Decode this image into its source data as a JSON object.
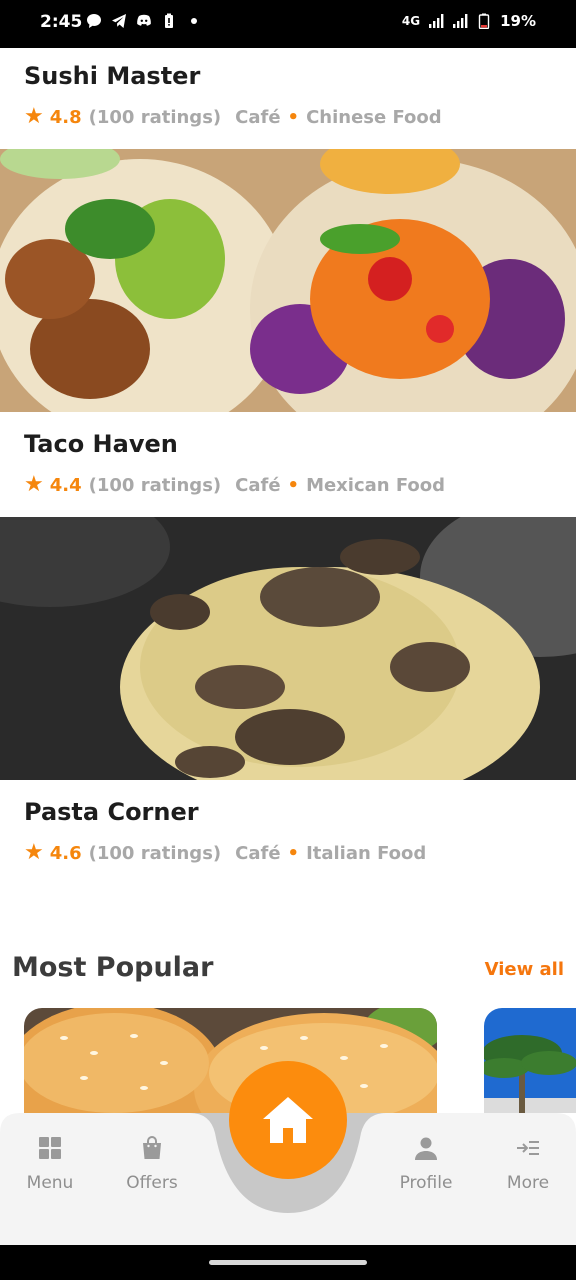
{
  "status": {
    "time": "2:45",
    "network": "4G",
    "battery": "19%"
  },
  "restaurants": [
    {
      "name": "Sushi Master",
      "rating": "4.8",
      "ratings_count": "(100 ratings)",
      "type": "Café",
      "cuisine": "Chinese Food"
    },
    {
      "name": "Taco Haven",
      "rating": "4.4",
      "ratings_count": "(100 ratings)",
      "type": "Café",
      "cuisine": "Mexican Food"
    },
    {
      "name": "Pasta Corner",
      "rating": "4.6",
      "ratings_count": "(100 ratings)",
      "type": "Café",
      "cuisine": "Italian Food"
    }
  ],
  "popular": {
    "title": "Most Popular",
    "view_all": "View all"
  },
  "tabs": {
    "menu": "Menu",
    "offers": "Offers",
    "profile": "Profile",
    "more": "More"
  },
  "icons": {
    "star": "star-icon",
    "home": "home-icon",
    "menu": "grid-icon",
    "offers": "shopping-bag-icon",
    "profile": "person-icon",
    "more": "more-icon"
  },
  "colors": {
    "accent": "#f5860d",
    "home_button": "#fc8c0d",
    "muted_text": "#a8a8a8",
    "tab_text": "#8f8f8f"
  }
}
